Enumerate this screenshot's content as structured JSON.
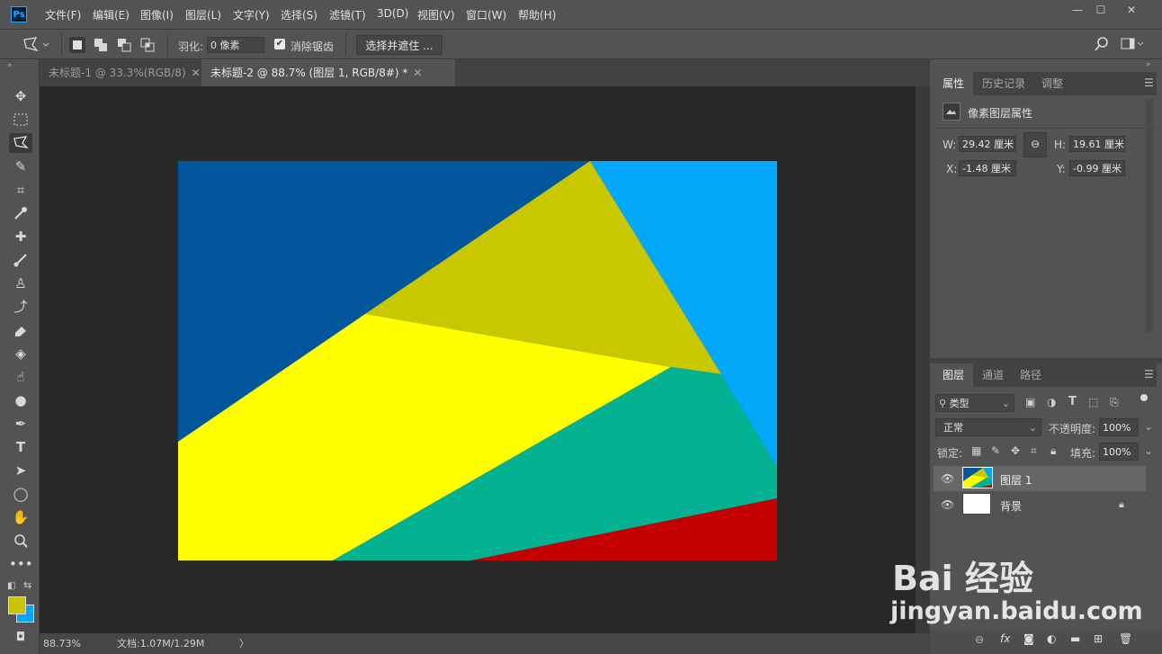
{
  "app": {
    "logo": "Ps"
  },
  "menu": [
    "文件(F)",
    "编辑(E)",
    "图像(I)",
    "图层(L)",
    "文字(Y)",
    "选择(S)",
    "滤镜(T)",
    "3D(D)",
    "视图(V)",
    "窗口(W)",
    "帮助(H)"
  ],
  "window_controls": {
    "minimize": "—",
    "maximize": "☐",
    "close": "✕"
  },
  "options": {
    "feather_label": "羽化:",
    "feather_value": "0 像素",
    "antialias_label": "消除锯齿",
    "antialias_checked": true,
    "select_mask_button": "选择并遮住 ..."
  },
  "tabs": [
    {
      "label": "未标题-1 @ 33.3%(RGB/8)",
      "active": false
    },
    {
      "label": "未标题-2 @ 88.7% (图层 1, RGB/8#) *",
      "active": true
    }
  ],
  "status": {
    "zoom": "88.73%",
    "doc": "文档:1.07M/1.29M"
  },
  "properties_panel": {
    "tabs": [
      "属性",
      "历史记录",
      "调整"
    ],
    "title": "像素图层属性",
    "w_label": "W:",
    "w_value": "29.42 厘米",
    "h_label": "H:",
    "h_value": "19.61 厘米",
    "x_label": "X:",
    "x_value": "-1.48 厘米",
    "y_label": "Y:",
    "y_value": "-0.99 厘米"
  },
  "layers_panel": {
    "tabs": [
      "图层",
      "通道",
      "路径"
    ],
    "filter_label": "类型",
    "blend_mode": "正常",
    "opacity_label": "不透明度:",
    "opacity_value": "100%",
    "lock_label": "锁定:",
    "fill_label": "填充:",
    "fill_value": "100%",
    "layers": [
      {
        "name": "图层 1",
        "selected": true,
        "locked": false
      },
      {
        "name": "背景",
        "selected": false,
        "locked": true
      }
    ]
  },
  "colors": {
    "foreground": "#c8c500",
    "background": "#00a5ff",
    "canvas": {
      "dark_blue": "#02569b",
      "light_blue": "#03a8fb",
      "olive": "#c9c700",
      "yellow": "#ffff00",
      "teal": "#02b293",
      "red": "#c40000"
    }
  },
  "watermark": {
    "logo": "Bai 经验",
    "url": "jingyan.baidu.com"
  }
}
